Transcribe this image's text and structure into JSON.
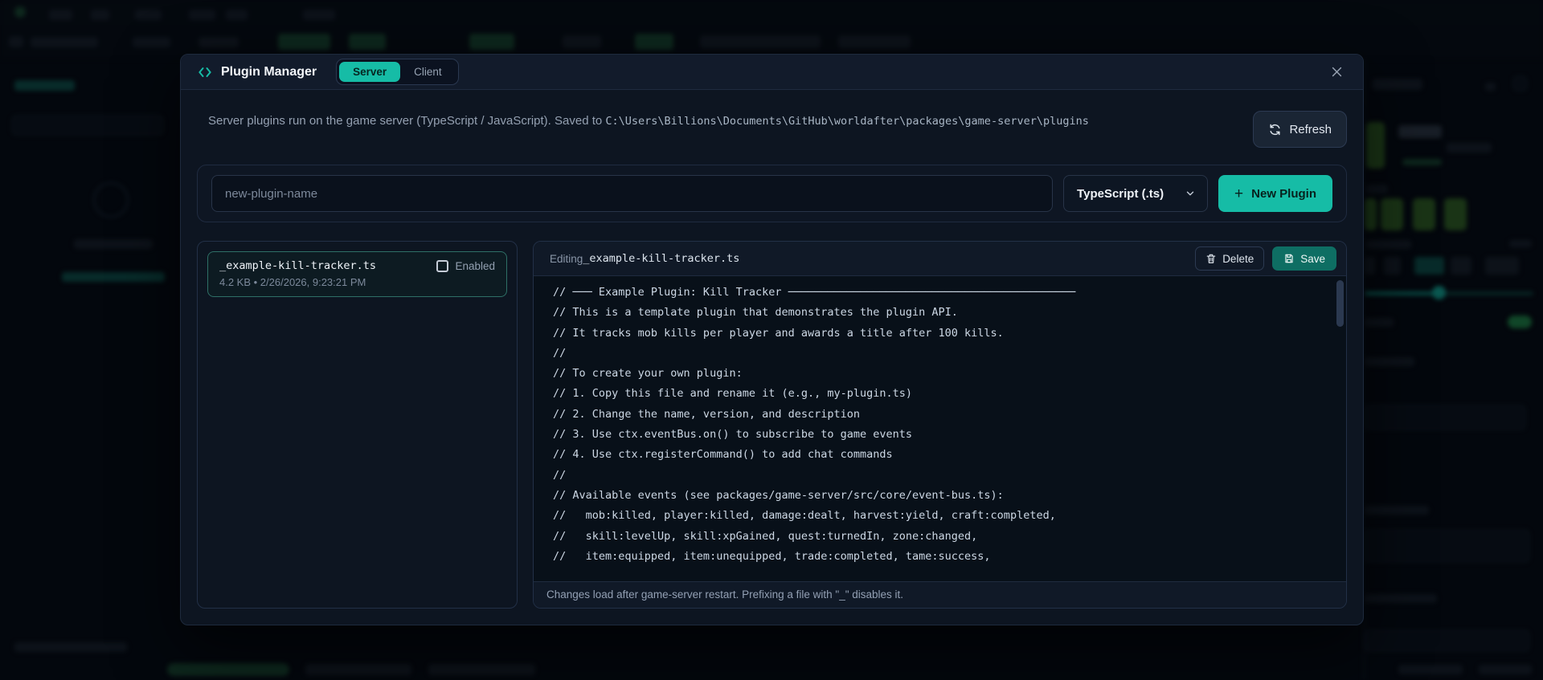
{
  "colors": {
    "accent_teal": "#16bca6",
    "save_teal": "#0e6e63"
  },
  "modal": {
    "title": "Plugin Manager",
    "tabs": {
      "server": "Server",
      "client": "Client"
    },
    "description": {
      "prefix": "Server plugins run on the game server (TypeScript / JavaScript). Saved to ",
      "path": "C:\\Users\\Billions\\Documents\\GitHub\\worldafter\\packages\\game-server\\plugins"
    },
    "refresh_label": "Refresh",
    "create": {
      "name_placeholder": "new-plugin-name",
      "language": "TypeScript (.ts)",
      "button": "New Plugin",
      "plus": "+"
    },
    "plugins": [
      {
        "filename": "_example-kill-tracker.ts",
        "enabled_label": "Enabled",
        "meta": "4.2 KB • 2/26/2026, 9:23:21 PM"
      }
    ],
    "editor": {
      "heading_prefix": "Editing ",
      "filename": "_example-kill-tracker.ts",
      "delete_label": "Delete",
      "save_label": "Save",
      "code_lines": [
        "// ─── Example Plugin: Kill Tracker ────────────────────────────────────────────",
        "// This is a template plugin that demonstrates the plugin API.",
        "// It tracks mob kills per player and awards a title after 100 kills.",
        "//",
        "// To create your own plugin:",
        "// 1. Copy this file and rename it (e.g., my-plugin.ts)",
        "// 2. Change the name, version, and description",
        "// 3. Use ctx.eventBus.on() to subscribe to game events",
        "// 4. Use ctx.registerCommand() to add chat commands",
        "//",
        "// Available events (see packages/game-server/src/core/event-bus.ts):",
        "//   mob:killed, player:killed, damage:dealt, harvest:yield, craft:completed,",
        "//   skill:levelUp, skill:xpGained, quest:turnedIn, zone:changed,",
        "//   item:equipped, item:unequipped, trade:completed, tame:success,"
      ],
      "footer_note": "Changes load after game-server restart. Prefixing a file with \"_\" disables it."
    }
  }
}
